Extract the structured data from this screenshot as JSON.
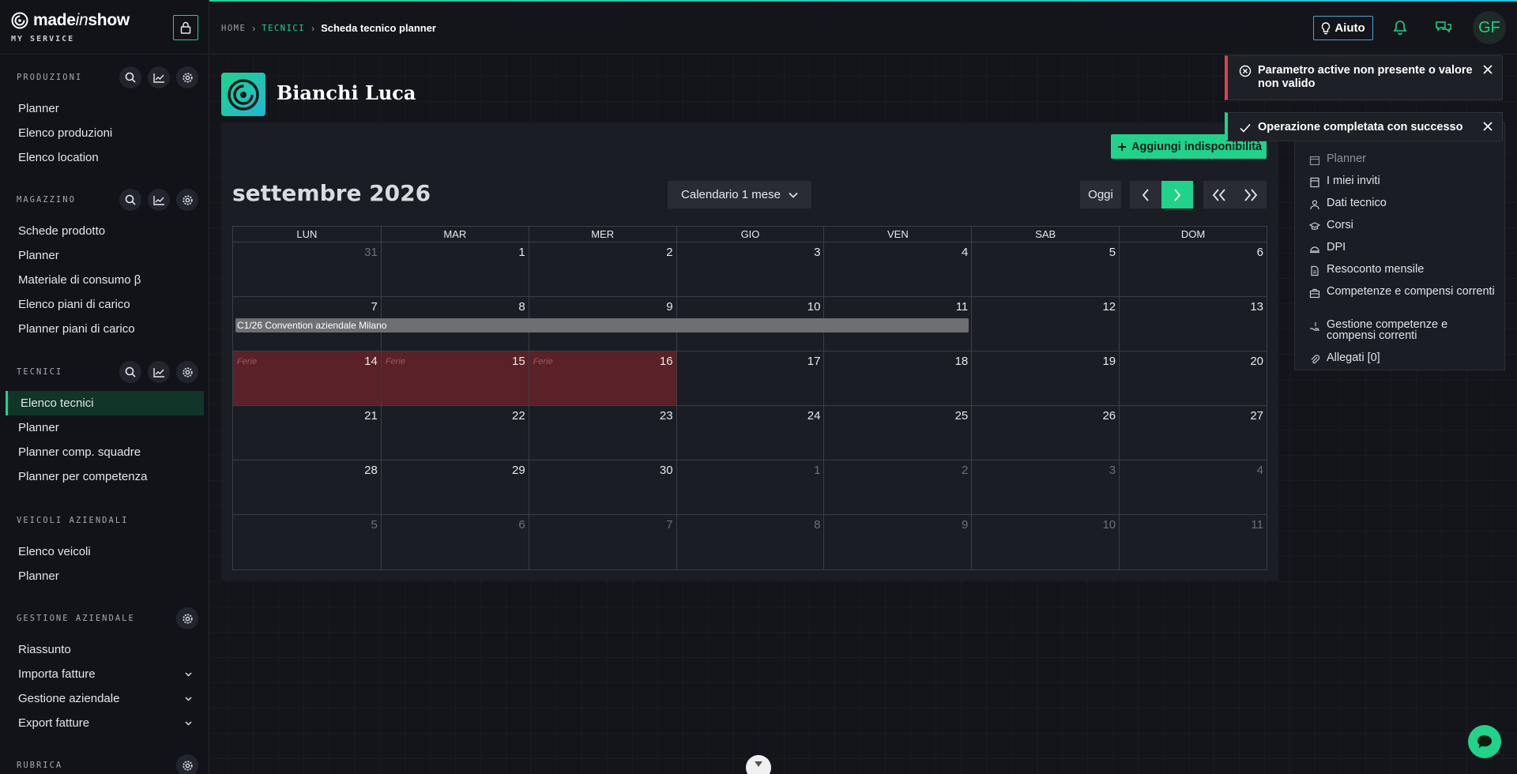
{
  "brand": {
    "name_a": "made",
    "name_b": "in",
    "name_c": "show",
    "subtitle": "MY SERVICE"
  },
  "sidebar": {
    "sections": [
      {
        "title": "PRODUZIONI",
        "items": [
          "Planner",
          "Elenco produzioni",
          "Elenco location"
        ]
      },
      {
        "title": "MAGAZZINO",
        "items": [
          "Schede prodotto",
          "Planner",
          "Materiale di consumo β",
          "Elenco piani di carico",
          "Planner piani di carico"
        ]
      },
      {
        "title": "TECNICI",
        "items": [
          "Elenco tecnici",
          "Planner",
          "Planner comp. squadre",
          "Planner per competenza"
        ],
        "active": "Elenco tecnici"
      },
      {
        "title": "VEICOLI AZIENDALI",
        "items": [
          "Elenco veicoli",
          "Planner"
        ]
      },
      {
        "title": "GESTIONE AZIENDALE",
        "items": [
          "Riassunto",
          "Importa fatture",
          "Gestione aziendale",
          "Export fatture"
        ]
      },
      {
        "title": "RUBRICA",
        "items": []
      }
    ]
  },
  "header": {
    "breadcrumb": {
      "home": "HOME",
      "section": "TECNICI",
      "current": "Scheda tecnico planner"
    },
    "help_label": "Aiuto",
    "avatar": "GF"
  },
  "technician": {
    "name": "Bianchi Luca"
  },
  "calendar": {
    "add_button": "Aggiungi indisponibilità",
    "month_title": "settembre 2026",
    "view_selector": "Calendario 1 mese",
    "today_label": "Oggi",
    "weekdays": [
      "LUN",
      "MAR",
      "MER",
      "GIO",
      "VEN",
      "SAB",
      "DOM"
    ],
    "weeks": [
      [
        "31",
        "1",
        "2",
        "3",
        "4",
        "5",
        "6"
      ],
      [
        "7",
        "8",
        "9",
        "10",
        "11",
        "12",
        "13"
      ],
      [
        "14",
        "15",
        "16",
        "17",
        "18",
        "19",
        "20"
      ],
      [
        "21",
        "22",
        "23",
        "24",
        "25",
        "26",
        "27"
      ],
      [
        "28",
        "29",
        "30",
        "1",
        "2",
        "3",
        "4"
      ],
      [
        "5",
        "6",
        "7",
        "8",
        "9",
        "10",
        "11"
      ]
    ],
    "event": "C1/26 Convention aziendale Milano",
    "leave_label": "Ferie"
  },
  "right_menu": {
    "items": [
      "Planner",
      "I miei inviti",
      "Dati tecnico",
      "Corsi",
      "DPI",
      "Resoconto mensile",
      "Competenze e compensi correnti",
      "Gestione competenze e compensi correnti",
      "Allegati [0]"
    ]
  },
  "toasts": {
    "error": "Parametro active non presente o valore non valido",
    "success": "Operazione completata con successo"
  },
  "colors": {
    "accent": "#1fd38a",
    "error": "#d9424f",
    "leave": "#5a2128",
    "event": "#6e6f73"
  }
}
